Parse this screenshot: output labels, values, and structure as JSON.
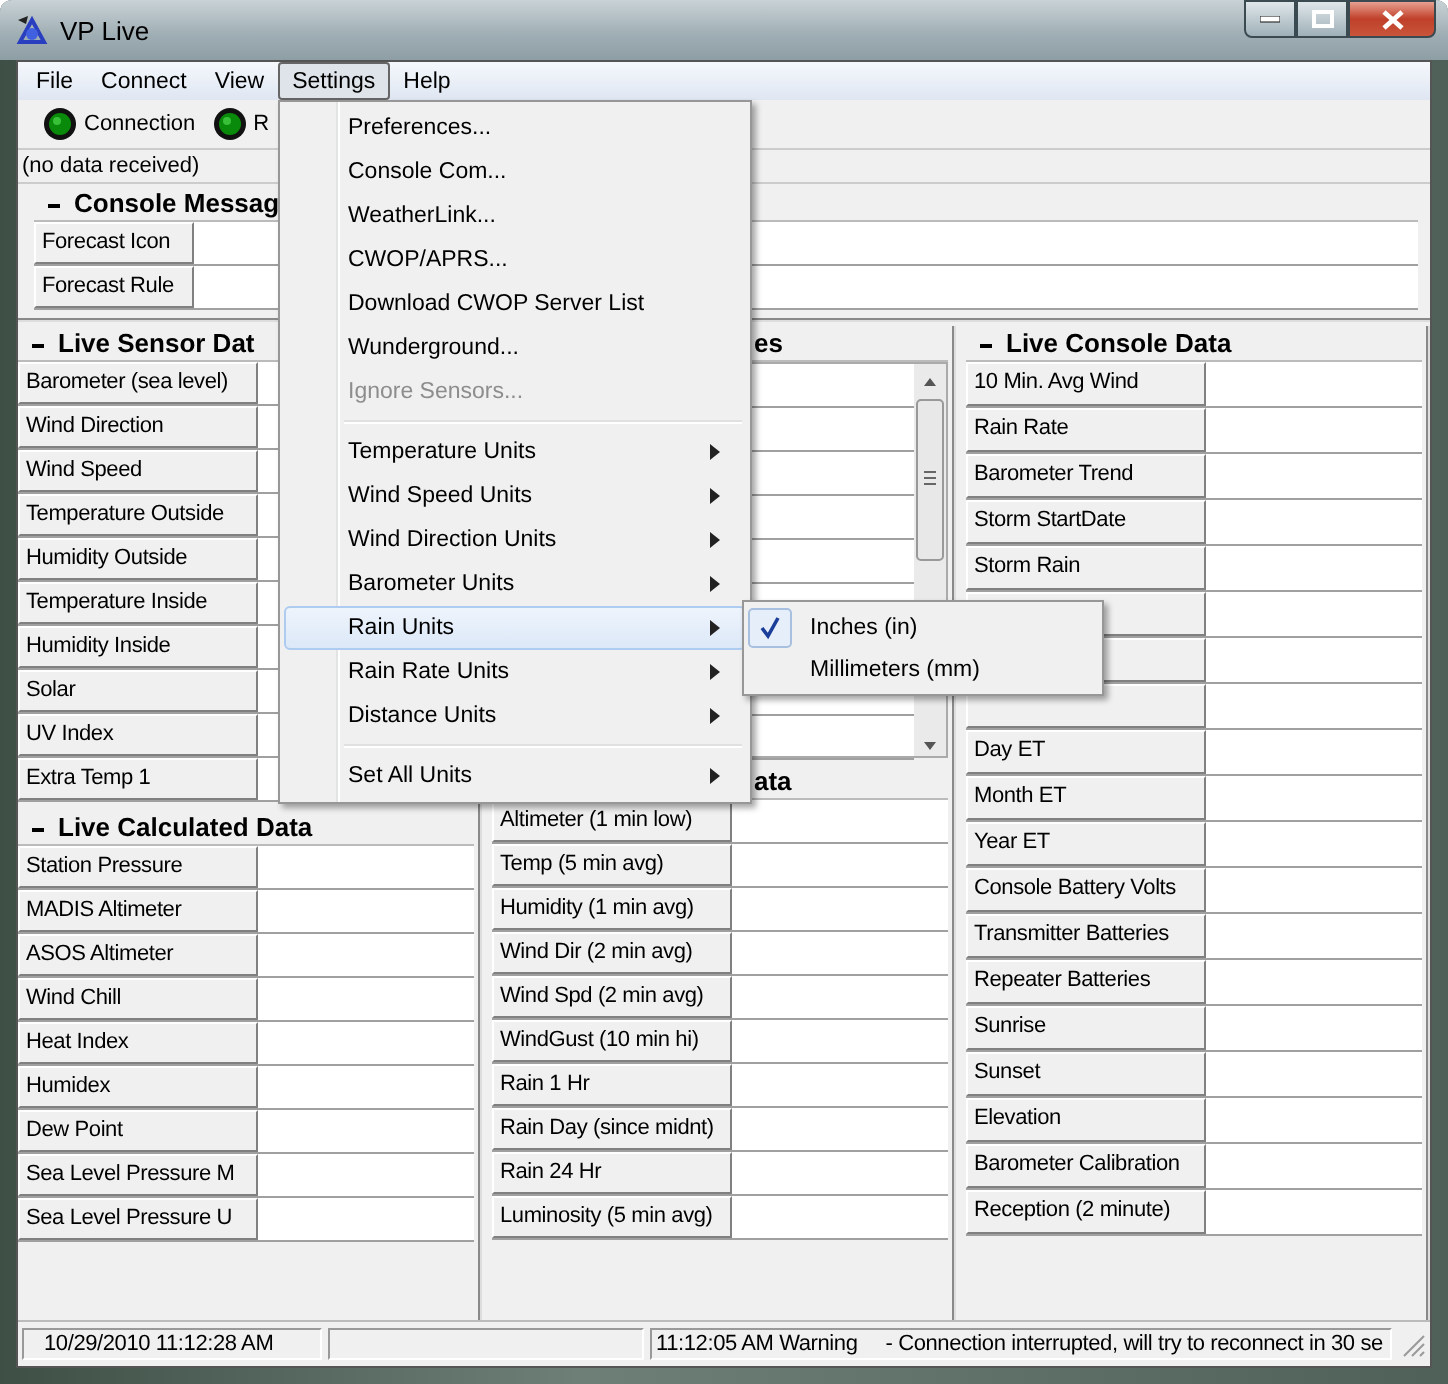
{
  "window": {
    "title": "VP Live"
  },
  "menu_bar": [
    {
      "label": "File",
      "selected": false
    },
    {
      "label": "Connect",
      "selected": false
    },
    {
      "label": "View",
      "selected": false
    },
    {
      "label": "Settings",
      "selected": true
    },
    {
      "label": "Help",
      "selected": false
    }
  ],
  "indicators": [
    {
      "label": "Connection"
    },
    {
      "label": "R"
    }
  ],
  "data_status": "(no data received)",
  "console_messages": {
    "title": "Console Messag",
    "rows": [
      {
        "label": "Forecast Icon"
      },
      {
        "label": "Forecast Rule"
      }
    ]
  },
  "live_sensor_data": {
    "title": "Live Sensor Dat",
    "rows": [
      {
        "label": "Barometer (sea level)"
      },
      {
        "label": "Wind Direction"
      },
      {
        "label": "Wind Speed"
      },
      {
        "label": "Temperature Outside"
      },
      {
        "label": "Humidity Outside"
      },
      {
        "label": "Temperature Inside"
      },
      {
        "label": "Humidity Inside"
      },
      {
        "label": "Solar"
      },
      {
        "label": "UV Index"
      },
      {
        "label": "Extra Temp 1"
      }
    ]
  },
  "live_calculated_data": {
    "title": "Live Calculated Data",
    "rows": [
      {
        "label": "Station Pressure"
      },
      {
        "label": "MADIS Altimeter"
      },
      {
        "label": "ASOS Altimeter"
      },
      {
        "label": "Wind Chill"
      },
      {
        "label": "Heat Index"
      },
      {
        "label": "Humidex"
      },
      {
        "label": "Dew Point"
      },
      {
        "label": "Sea Level Pressure M"
      },
      {
        "label": "Sea Level Pressure U"
      }
    ]
  },
  "center_upper": {
    "title": "es"
  },
  "center_lower": {
    "title": "ata",
    "rows": [
      {
        "label": "Altimeter (1 min low)"
      },
      {
        "label": "Temp (5 min avg)"
      },
      {
        "label": "Humidity (1 min avg)"
      },
      {
        "label": "Wind Dir (2 min avg)"
      },
      {
        "label": "Wind Spd (2 min avg)"
      },
      {
        "label": "WindGust (10 min hi)"
      },
      {
        "label": "Rain 1 Hr"
      },
      {
        "label": "Rain Day (since midnt)"
      },
      {
        "label": "Rain 24 Hr"
      },
      {
        "label": "Luminosity (5 min avg)"
      }
    ]
  },
  "live_console_data": {
    "title": "Live Console Data",
    "rows": [
      {
        "label": "10 Min. Avg Wind"
      },
      {
        "label": "Rain Rate"
      },
      {
        "label": "Barometer Trend"
      },
      {
        "label": "Storm StartDate"
      },
      {
        "label": "Storm Rain"
      },
      {},
      {},
      {},
      {
        "label": "Day ET"
      },
      {
        "label": "Month ET"
      },
      {
        "label": "Year ET"
      },
      {
        "label": "Console Battery Volts"
      },
      {
        "label": "Transmitter Batteries"
      },
      {
        "label": "Repeater Batteries"
      },
      {
        "label": "Sunrise"
      },
      {
        "label": "Sunset"
      },
      {
        "label": "Elevation"
      },
      {
        "label": "Barometer Calibration"
      },
      {
        "label": "Reception (2 minute)"
      }
    ]
  },
  "settings_menu": [
    {
      "kind": "item",
      "label": "Preferences...",
      "disabled": false,
      "submenu": false,
      "selected": false
    },
    {
      "kind": "item",
      "label": "Console Com...",
      "disabled": false,
      "submenu": false,
      "selected": false
    },
    {
      "kind": "item",
      "label": "WeatherLink...",
      "disabled": false,
      "submenu": false,
      "selected": false
    },
    {
      "kind": "item",
      "label": "CWOP/APRS...",
      "disabled": false,
      "submenu": false,
      "selected": false
    },
    {
      "kind": "item",
      "label": "Download CWOP Server List",
      "disabled": false,
      "submenu": false,
      "selected": false
    },
    {
      "kind": "item",
      "label": "Wunderground...",
      "disabled": false,
      "submenu": false,
      "selected": false
    },
    {
      "kind": "item",
      "label": "Ignore Sensors...",
      "disabled": true,
      "submenu": false,
      "selected": false
    },
    {
      "kind": "separator"
    },
    {
      "kind": "item",
      "label": "Temperature Units",
      "disabled": false,
      "submenu": true,
      "selected": false
    },
    {
      "kind": "item",
      "label": "Wind Speed Units",
      "disabled": false,
      "submenu": true,
      "selected": false
    },
    {
      "kind": "item",
      "label": "Wind Direction Units",
      "disabled": false,
      "submenu": true,
      "selected": false
    },
    {
      "kind": "item",
      "label": "Barometer Units",
      "disabled": false,
      "submenu": true,
      "selected": false
    },
    {
      "kind": "item",
      "label": "Rain Units",
      "disabled": false,
      "submenu": true,
      "selected": true
    },
    {
      "kind": "item",
      "label": "Rain Rate Units",
      "disabled": false,
      "submenu": true,
      "selected": false
    },
    {
      "kind": "item",
      "label": "Distance Units",
      "disabled": false,
      "submenu": true,
      "selected": false
    },
    {
      "kind": "separator"
    },
    {
      "kind": "item",
      "label": "Set All Units",
      "disabled": false,
      "submenu": true,
      "selected": false
    }
  ],
  "rain_units_submenu": [
    {
      "label": "Inches (in)",
      "checked": true
    },
    {
      "label": "Millimeters (mm)",
      "checked": false
    }
  ],
  "status_bar": {
    "datetime": "10/29/2010 11:12:28 AM",
    "message_time": "11:12:05 AM Warning",
    "message": "- Connection interrupted, will try to reconnect in 30 se"
  }
}
